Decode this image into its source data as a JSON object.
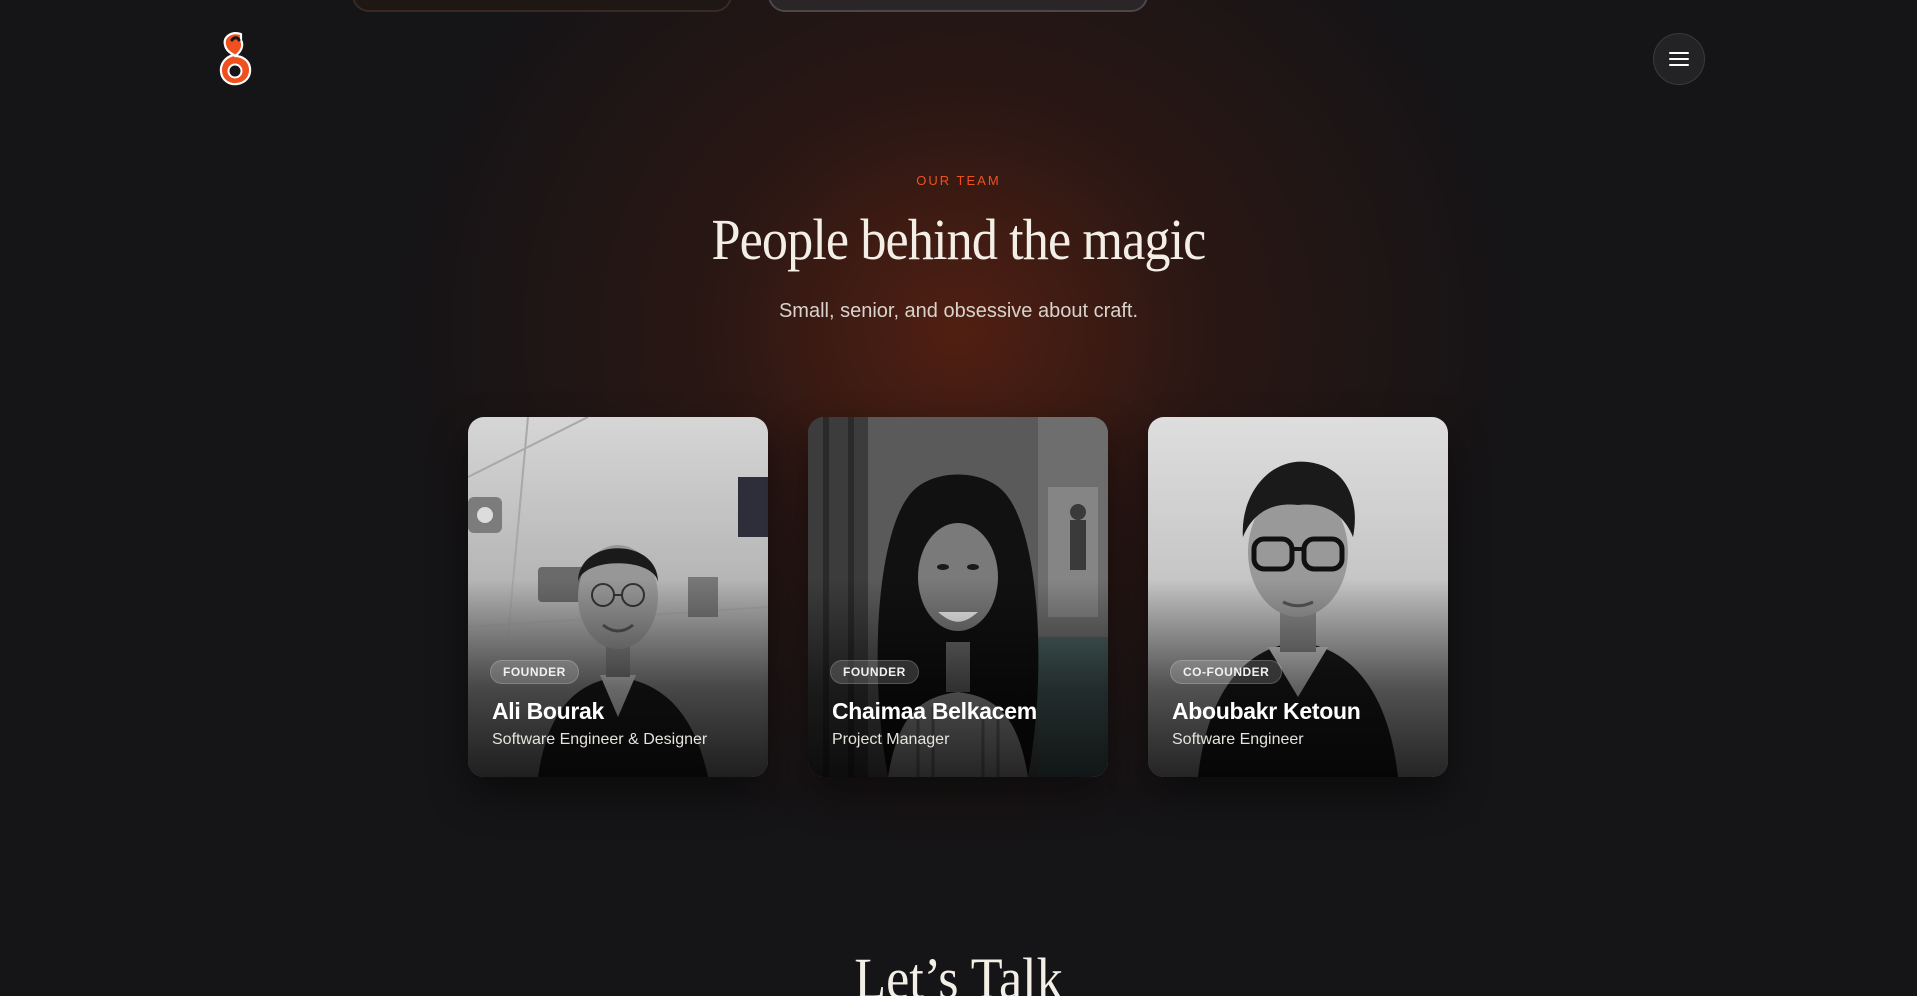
{
  "header": {
    "logo_icon": "brand-logo-icon",
    "menu_icon": "hamburger-menu-icon",
    "accent_color": "#f0501e"
  },
  "team": {
    "eyebrow": "OUR TEAM",
    "title": "People behind the magic",
    "subtitle": "Small, senior, and obsessive about craft.",
    "members": [
      {
        "badge": "FOUNDER",
        "name": "Ali Bourak",
        "role": "Software Engineer & Designer"
      },
      {
        "badge": "FOUNDER",
        "name": "Chaimaa Belkacem",
        "role": "Project Manager"
      },
      {
        "badge": "CO-FOUNDER",
        "name": "Aboubakr Ketoun",
        "role": "Software Engineer"
      }
    ]
  },
  "contact": {
    "title": "Let’s Talk"
  }
}
